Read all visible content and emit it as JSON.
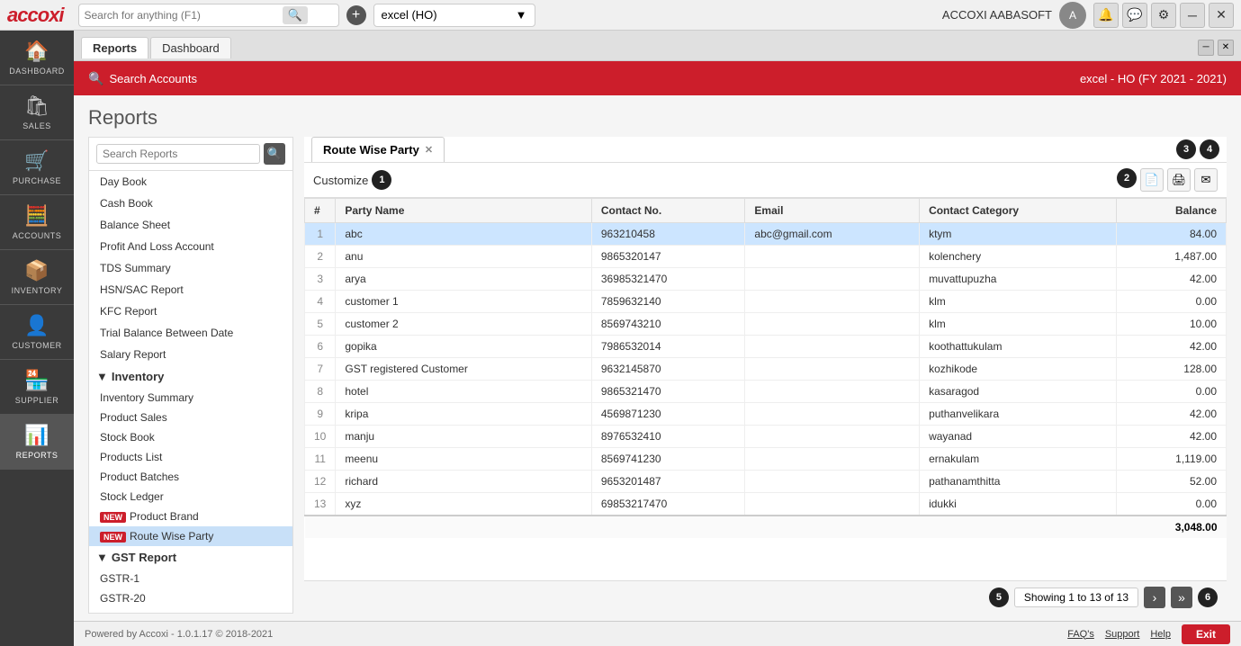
{
  "topbar": {
    "logo": "accoxi",
    "search_placeholder": "Search for anything (F1)",
    "company": "excel (HO)",
    "user": "ACCOXI AABASOFT",
    "icons": [
      "🔔",
      "💬",
      "⚙",
      "─",
      "✕"
    ]
  },
  "tabs": [
    {
      "label": "Reports",
      "active": true
    },
    {
      "label": "Dashboard",
      "active": false
    }
  ],
  "red_header": {
    "search_label": "Search Accounts",
    "fy_label": "excel - HO (FY 2021 - 2021)"
  },
  "page": {
    "title": "Reports"
  },
  "reports_search": {
    "placeholder": "Search Reports"
  },
  "sidebar": {
    "items": [
      {
        "label": "DASHBOARD",
        "icon": "🏠"
      },
      {
        "label": "SALES",
        "icon": "🛍"
      },
      {
        "label": "PURCHASE",
        "icon": "🛒"
      },
      {
        "label": "ACCOUNTS",
        "icon": "🧮"
      },
      {
        "label": "INVENTORY",
        "icon": "📦"
      },
      {
        "label": "CUSTOMER",
        "icon": "👤"
      },
      {
        "label": "SUPPLIER",
        "icon": "🏪"
      },
      {
        "label": "REPORTS",
        "icon": "📊"
      }
    ]
  },
  "left_panel": {
    "items": [
      {
        "label": "Day Book",
        "type": "item",
        "indent": false
      },
      {
        "label": "Cash Book",
        "type": "item",
        "indent": false
      },
      {
        "label": "Balance Sheet",
        "type": "item",
        "indent": false
      },
      {
        "label": "Profit And Loss Account",
        "type": "item",
        "indent": false
      },
      {
        "label": "TDS Summary",
        "type": "item",
        "indent": false
      },
      {
        "label": "HSN/SAC Report",
        "type": "item",
        "indent": false
      },
      {
        "label": "KFC Report",
        "type": "item",
        "indent": false
      },
      {
        "label": "Trial Balance Between Date",
        "type": "item",
        "indent": false
      },
      {
        "label": "Salary Report",
        "type": "item",
        "indent": false
      },
      {
        "label": "Inventory",
        "type": "section"
      },
      {
        "label": "Inventory Summary",
        "type": "sub"
      },
      {
        "label": "Product Sales",
        "type": "sub"
      },
      {
        "label": "Stock Book",
        "type": "sub"
      },
      {
        "label": "Products List",
        "type": "sub"
      },
      {
        "label": "Product Batches",
        "type": "sub"
      },
      {
        "label": "Stock Ledger",
        "type": "sub"
      },
      {
        "label": "Product Brand",
        "type": "sub",
        "new": true
      },
      {
        "label": "Route Wise Party",
        "type": "sub",
        "new": true,
        "active": true
      },
      {
        "label": "GST Report",
        "type": "section"
      },
      {
        "label": "GSTR-1",
        "type": "sub"
      },
      {
        "label": "GSTR-20",
        "type": "sub"
      }
    ]
  },
  "report_tab": {
    "label": "Route Wise Party",
    "badges": [
      "3",
      "4"
    ],
    "customize_label": "Customize",
    "action_icons": [
      "📄",
      "🖨",
      "✉"
    ]
  },
  "table": {
    "columns": [
      "#",
      "Party Name",
      "Contact No.",
      "Email",
      "Contact Category",
      "Balance"
    ],
    "rows": [
      {
        "num": 1,
        "party": "abc",
        "contact": "963210458",
        "email": "abc@gmail.com",
        "category": "ktym",
        "balance": "84.00",
        "selected": true
      },
      {
        "num": 2,
        "party": "anu",
        "contact": "9865320147",
        "email": "",
        "category": "kolenchery",
        "balance": "1,487.00"
      },
      {
        "num": 3,
        "party": "arya",
        "contact": "36985321470",
        "email": "",
        "category": "muvattupuzha",
        "balance": "42.00"
      },
      {
        "num": 4,
        "party": "customer 1",
        "contact": "7859632140",
        "email": "",
        "category": "klm",
        "balance": "0.00"
      },
      {
        "num": 5,
        "party": "customer 2",
        "contact": "8569743210",
        "email": "",
        "category": "klm",
        "balance": "10.00"
      },
      {
        "num": 6,
        "party": "gopika",
        "contact": "7986532014",
        "email": "",
        "category": "koothattukulam",
        "balance": "42.00"
      },
      {
        "num": 7,
        "party": "GST registered Customer",
        "contact": "9632145870",
        "email": "",
        "category": "kozhikode",
        "balance": "128.00"
      },
      {
        "num": 8,
        "party": "hotel",
        "contact": "9865321470",
        "email": "",
        "category": "kasaragod",
        "balance": "0.00"
      },
      {
        "num": 9,
        "party": "kripa",
        "contact": "4569871230",
        "email": "",
        "category": "puthanvelikara",
        "balance": "42.00"
      },
      {
        "num": 10,
        "party": "manju",
        "contact": "8976532410",
        "email": "",
        "category": "wayanad",
        "balance": "42.00"
      },
      {
        "num": 11,
        "party": "meenu",
        "contact": "8569741230",
        "email": "",
        "category": "ernakulam",
        "balance": "1,119.00"
      },
      {
        "num": 12,
        "party": "richard",
        "contact": "9653201487",
        "email": "",
        "category": "pathanamthitta",
        "balance": "52.00"
      },
      {
        "num": 13,
        "party": "xyz",
        "contact": "69853217470",
        "email": "",
        "category": "idukki",
        "balance": "0.00"
      }
    ],
    "total": "3,048.00"
  },
  "pagination": {
    "info": "Showing 1 to 13 of 13",
    "badge": "5",
    "next_icon": "›",
    "last_icon": "»",
    "page_num": "6"
  },
  "footer": {
    "powered_by": "Powered by Accoxi - 1.0.1.17 © 2018-2021",
    "links": [
      "FAQ's",
      "Support",
      "Help"
    ],
    "exit_label": "Exit"
  }
}
